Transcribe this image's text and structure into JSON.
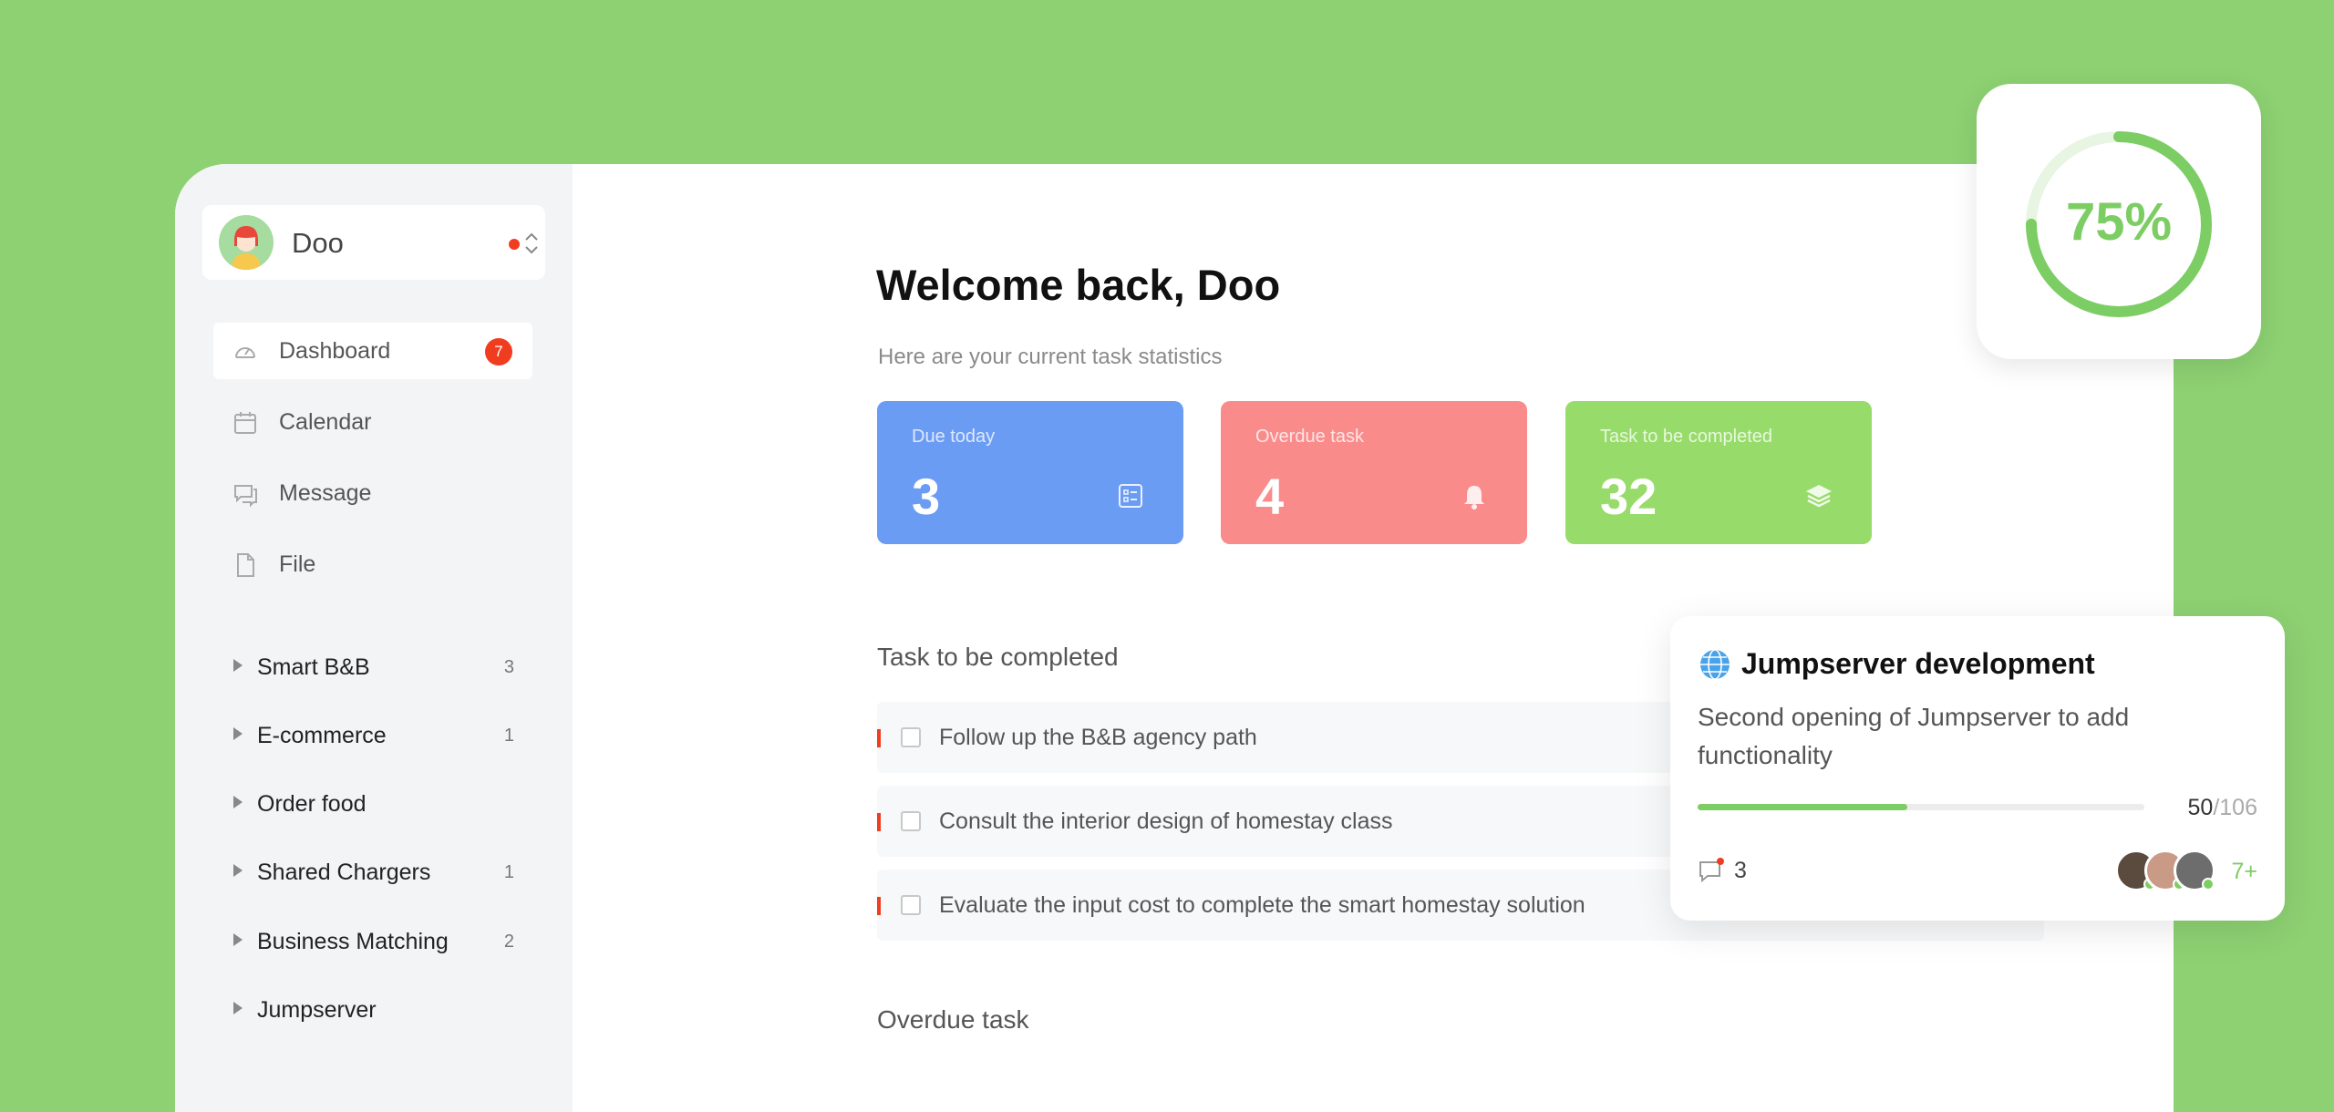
{
  "user": {
    "name": "Doo"
  },
  "nav": [
    {
      "label": "Dashboard",
      "icon": "dashboard-icon",
      "badge": "7",
      "active": true
    },
    {
      "label": "Calendar",
      "icon": "calendar-icon"
    },
    {
      "label": "Message",
      "icon": "message-icon"
    },
    {
      "label": "File",
      "icon": "file-icon"
    }
  ],
  "projects": [
    {
      "label": "Smart B&B",
      "count": "3"
    },
    {
      "label": "E-commerce",
      "count": "1"
    },
    {
      "label": "Order food",
      "count": ""
    },
    {
      "label": "Shared Chargers",
      "count": "1"
    },
    {
      "label": "Business Matching",
      "count": "2"
    },
    {
      "label": "Jumpserver",
      "count": ""
    }
  ],
  "main": {
    "title": "Welcome back, Doo",
    "subtitle": "Here are your current task statistics",
    "stats": [
      {
        "label": "Due today",
        "value": "3",
        "color": "#6b9cf3",
        "icon": "checklist-icon"
      },
      {
        "label": "Overdue task",
        "value": "4",
        "color": "#fa8b8b",
        "icon": "bell-icon"
      },
      {
        "label": "Task to be completed",
        "value": "32",
        "color": "#97dc6a",
        "icon": "layers-icon"
      }
    ],
    "sections": {
      "todo_title": "Task to be completed",
      "overdue_title": "Overdue task"
    },
    "tasks": [
      "Follow up the B&B agency path",
      "Consult the interior design of homestay class",
      "Evaluate the input cost to complete the smart homestay solution"
    ]
  },
  "progress": {
    "percent_label": "75%",
    "value": 0.75,
    "color": "#7ccd64"
  },
  "project_card": {
    "title": "Jumpserver development",
    "description": "Second opening of Jumpserver to add functionality",
    "done": "50",
    "total": "/106",
    "progress": 0.47,
    "comments": "3",
    "more": "7+"
  }
}
